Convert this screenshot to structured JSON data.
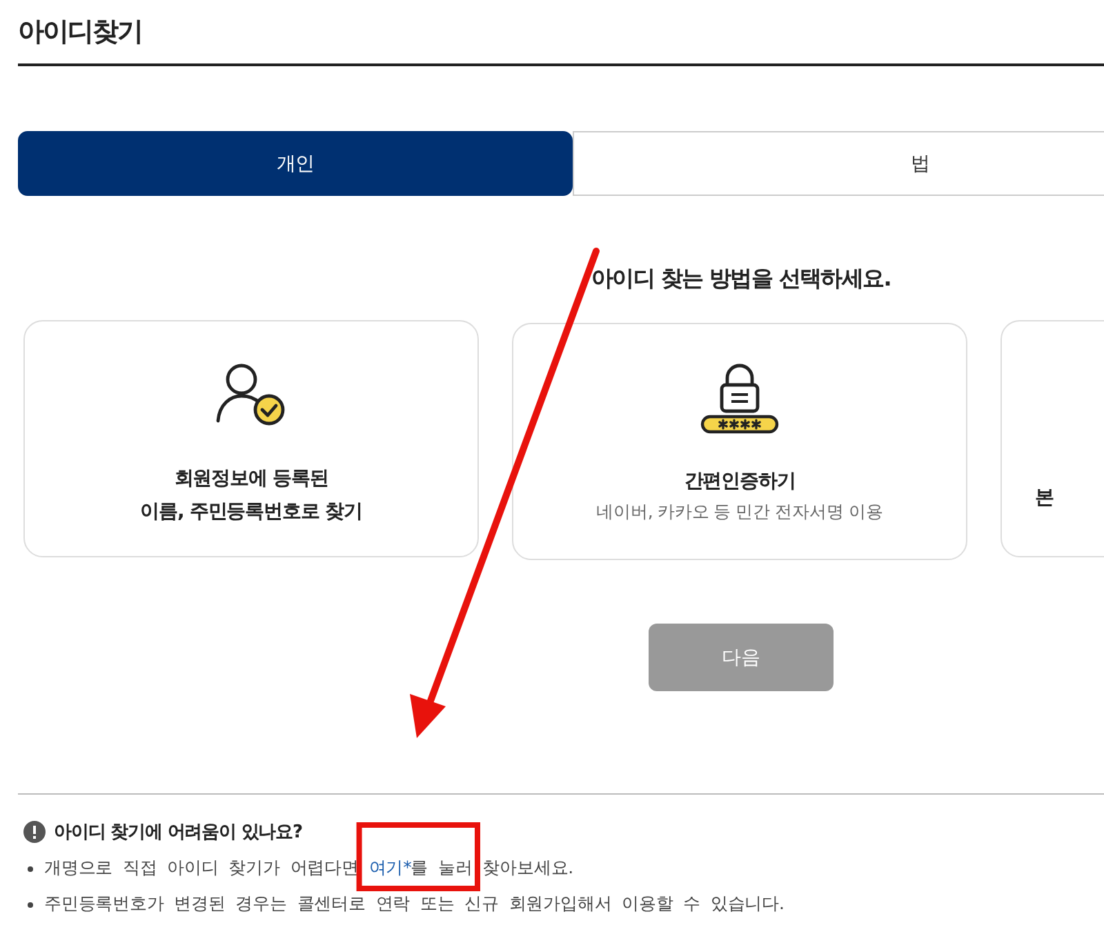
{
  "page": {
    "title": "아이디찾기"
  },
  "tabs": [
    {
      "label": "개인",
      "selected": true
    },
    {
      "label": "법",
      "selected": false
    }
  ],
  "prompt": "아이디 찾는 방법을 선택하세요.",
  "methods": [
    {
      "kind": "member",
      "title_lines": [
        "회원정보에 등록된",
        "이름, 주민등록번호로 찾기"
      ]
    },
    {
      "kind": "simple-auth",
      "title_lines": [
        "간편인증하기"
      ],
      "subtitle": "네이버, 카카오 등 민간 전자서명 이용"
    },
    {
      "kind": "other",
      "title_lines": [
        "본"
      ]
    }
  ],
  "next_button": {
    "label": "다음",
    "disabled": true
  },
  "help": {
    "title": "아이디 찾기에 어려움이 있나요?",
    "bullets": [
      {
        "before": "개명으로 직접 아이디 찾기가 어렵다면 ",
        "link": "여기*",
        "after": "를 눌러 찾아보세요."
      },
      {
        "before": "주민등록번호가 변경된 경우는 콜센터로 연락 또는 신규 회원가입해서 이용할 수 있습니다."
      }
    ]
  }
}
